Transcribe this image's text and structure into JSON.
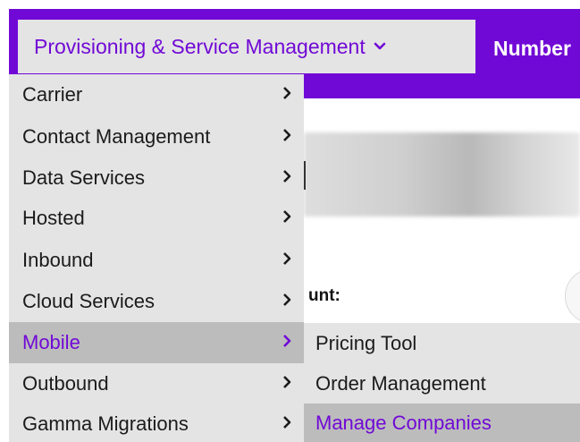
{
  "navbar": {
    "menu_label": "Provisioning & Service Management",
    "next_label": "Number"
  },
  "background": {
    "partial_label": "unt:"
  },
  "dropdown": {
    "items": [
      {
        "label": "Carrier"
      },
      {
        "label": "Contact Management"
      },
      {
        "label": "Data Services"
      },
      {
        "label": "Hosted"
      },
      {
        "label": "Inbound"
      },
      {
        "label": "Cloud Services"
      },
      {
        "label": "Mobile",
        "active": true
      },
      {
        "label": "Outbound"
      },
      {
        "label": "Gamma Migrations"
      }
    ]
  },
  "submenu": {
    "items": [
      {
        "label": "Pricing Tool"
      },
      {
        "label": "Order Management"
      },
      {
        "label": "Manage Companies",
        "active": true
      }
    ]
  },
  "colors": {
    "brand": "#7109d6",
    "menu_bg": "#e4e4e4",
    "hover_bg": "#bcbcbc",
    "text": "#1b1b1b"
  },
  "icons": {
    "nav_chevron": "chevron-down-icon",
    "item_arrow": "chevron-right-icon"
  }
}
